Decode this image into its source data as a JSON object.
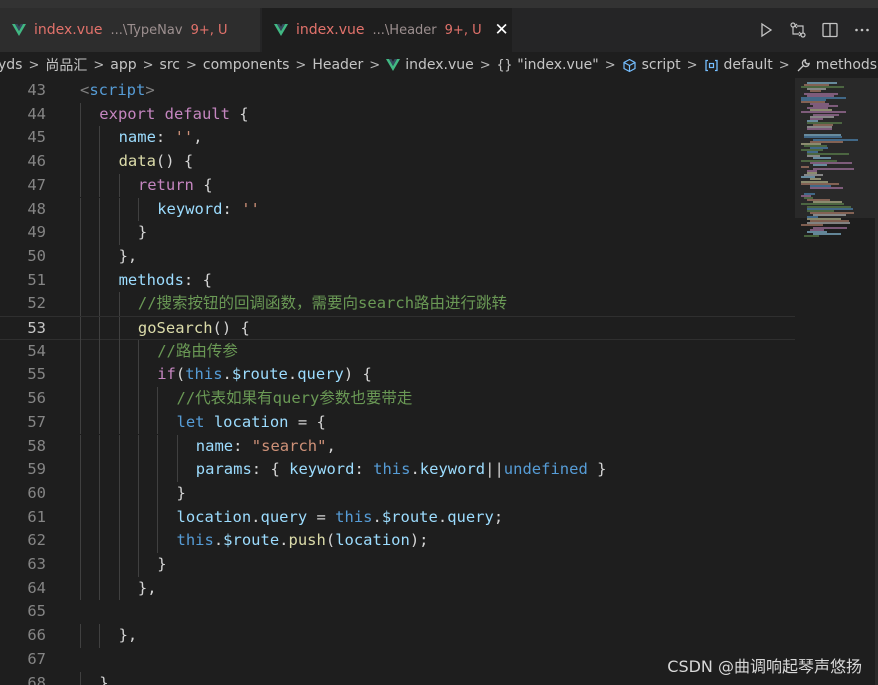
{
  "tabs": [
    {
      "filename": "index.vue",
      "path": "...\\TypeNav",
      "status": "9+, U",
      "active": false,
      "icon": "vue-icon"
    },
    {
      "filename": "index.vue",
      "path": "...\\Header",
      "status": "9+, U",
      "active": true,
      "icon": "vue-icon"
    }
  ],
  "tab_close_glyph": "✕",
  "actions": [
    {
      "name": "run-icon",
      "glyph": "▷"
    },
    {
      "name": "compare-changes-icon",
      "glyph": "⇄"
    },
    {
      "name": "split-editor-icon",
      "glyph": "◫"
    },
    {
      "name": "more-actions-icon",
      "glyph": "···"
    }
  ],
  "breadcrumb": [
    {
      "label": "yds",
      "icon": null
    },
    {
      "label": "尚品汇",
      "icon": null
    },
    {
      "label": "app",
      "icon": null
    },
    {
      "label": "src",
      "icon": null
    },
    {
      "label": "components",
      "icon": null
    },
    {
      "label": "Header",
      "icon": null
    },
    {
      "label": "index.vue",
      "icon": "vue-icon"
    },
    {
      "label": "\"index.vue\"",
      "icon": "braces-icon"
    },
    {
      "label": "script",
      "icon": "cube-icon"
    },
    {
      "label": "default",
      "icon": "module-icon"
    },
    {
      "label": "methods",
      "icon": "wrench-icon"
    }
  ],
  "current_line": 53,
  "code_lines": [
    {
      "n": "43",
      "indent": 0,
      "tokens": [
        [
          "tag",
          "<"
        ],
        [
          "tagname",
          "script"
        ],
        [
          "tag",
          ">"
        ]
      ]
    },
    {
      "n": "44",
      "indent": 1,
      "tokens": [
        [
          "kw",
          "export"
        ],
        [
          "p",
          " "
        ],
        [
          "kw",
          "default"
        ],
        [
          "p",
          " {"
        ]
      ]
    },
    {
      "n": "45",
      "indent": 2,
      "tokens": [
        [
          "prop",
          "name"
        ],
        [
          "p",
          ": "
        ],
        [
          "str",
          "''"
        ],
        [
          "p",
          ","
        ]
      ]
    },
    {
      "n": "46",
      "indent": 2,
      "tokens": [
        [
          "fn",
          "data"
        ],
        [
          "p",
          "() {"
        ]
      ]
    },
    {
      "n": "47",
      "indent": 3,
      "tokens": [
        [
          "kw",
          "return"
        ],
        [
          "p",
          " {"
        ]
      ]
    },
    {
      "n": "48",
      "indent": 4,
      "tokens": [
        [
          "prop",
          "keyword"
        ],
        [
          "p",
          ": "
        ],
        [
          "str",
          "''"
        ]
      ]
    },
    {
      "n": "49",
      "indent": 3,
      "tokens": [
        [
          "p",
          "}"
        ]
      ]
    },
    {
      "n": "50",
      "indent": 2,
      "tokens": [
        [
          "p",
          "},"
        ]
      ]
    },
    {
      "n": "51",
      "indent": 2,
      "tokens": [
        [
          "prop",
          "methods"
        ],
        [
          "p",
          ": {"
        ]
      ]
    },
    {
      "n": "52",
      "indent": 3,
      "tokens": [
        [
          "com",
          "//搜索按钮的回调函数，需要向search路由进行跳转"
        ]
      ]
    },
    {
      "n": "53",
      "indent": 3,
      "tokens": [
        [
          "fn",
          "goSearch"
        ],
        [
          "p",
          "() "
        ],
        [
          "p",
          "{"
        ]
      ]
    },
    {
      "n": "54",
      "indent": 4,
      "tokens": [
        [
          "com",
          "//路由传参"
        ]
      ]
    },
    {
      "n": "55",
      "indent": 4,
      "tokens": [
        [
          "kw",
          "if"
        ],
        [
          "p",
          "("
        ],
        [
          "kwb",
          "this"
        ],
        [
          "p",
          "."
        ],
        [
          "var",
          "$route"
        ],
        [
          "p",
          "."
        ],
        [
          "var",
          "query"
        ],
        [
          "p",
          ") {"
        ]
      ]
    },
    {
      "n": "56",
      "indent": 5,
      "tokens": [
        [
          "com",
          "//代表如果有query参数也要带走"
        ]
      ]
    },
    {
      "n": "57",
      "indent": 5,
      "tokens": [
        [
          "kwb",
          "let"
        ],
        [
          "p",
          " "
        ],
        [
          "var",
          "location"
        ],
        [
          "p",
          " = {"
        ]
      ]
    },
    {
      "n": "58",
      "indent": 6,
      "tokens": [
        [
          "prop",
          "name"
        ],
        [
          "p",
          ": "
        ],
        [
          "str",
          "\"search\""
        ],
        [
          "p",
          ","
        ]
      ]
    },
    {
      "n": "59",
      "indent": 6,
      "tokens": [
        [
          "prop",
          "params"
        ],
        [
          "p",
          ": { "
        ],
        [
          "prop",
          "keyword"
        ],
        [
          "p",
          ": "
        ],
        [
          "kwb",
          "this"
        ],
        [
          "p",
          "."
        ],
        [
          "var",
          "keyword"
        ],
        [
          "p",
          "||"
        ],
        [
          "kwb",
          "undefined"
        ],
        [
          "p",
          " }"
        ]
      ]
    },
    {
      "n": "60",
      "indent": 5,
      "tokens": [
        [
          "p",
          "}"
        ]
      ]
    },
    {
      "n": "61",
      "indent": 5,
      "tokens": [
        [
          "var",
          "location"
        ],
        [
          "p",
          "."
        ],
        [
          "var",
          "query"
        ],
        [
          "p",
          " = "
        ],
        [
          "kwb",
          "this"
        ],
        [
          "p",
          "."
        ],
        [
          "var",
          "$route"
        ],
        [
          "p",
          "."
        ],
        [
          "var",
          "query"
        ],
        [
          "p",
          ";"
        ]
      ]
    },
    {
      "n": "62",
      "indent": 5,
      "tokens": [
        [
          "kwb",
          "this"
        ],
        [
          "p",
          "."
        ],
        [
          "var",
          "$route"
        ],
        [
          "p",
          "."
        ],
        [
          "fn",
          "push"
        ],
        [
          "p",
          "("
        ],
        [
          "var",
          "location"
        ],
        [
          "p",
          ");"
        ]
      ]
    },
    {
      "n": "63",
      "indent": 4,
      "tokens": [
        [
          "p",
          "}"
        ]
      ]
    },
    {
      "n": "64",
      "indent": 3,
      "tokens": [
        [
          "p",
          "}"
        ],
        [
          "p",
          ","
        ]
      ]
    },
    {
      "n": "65",
      "indent": 0,
      "tokens": []
    },
    {
      "n": "66",
      "indent": 2,
      "tokens": [
        [
          "p",
          "},"
        ]
      ]
    },
    {
      "n": "67",
      "indent": 0,
      "tokens": []
    },
    {
      "n": "68",
      "indent": 1,
      "tokens": [
        [
          "p",
          "}"
        ]
      ]
    }
  ],
  "watermark": "CSDN @曲调响起琴声悠扬",
  "colors": {
    "accent_vue": "#41b883",
    "modified_red": "#e2726b",
    "keyword": "#c586c0",
    "builtin": "#569cd6",
    "property": "#9cdcfe",
    "function": "#dcdcaa",
    "string": "#ce9178",
    "comment": "#6a9955"
  }
}
